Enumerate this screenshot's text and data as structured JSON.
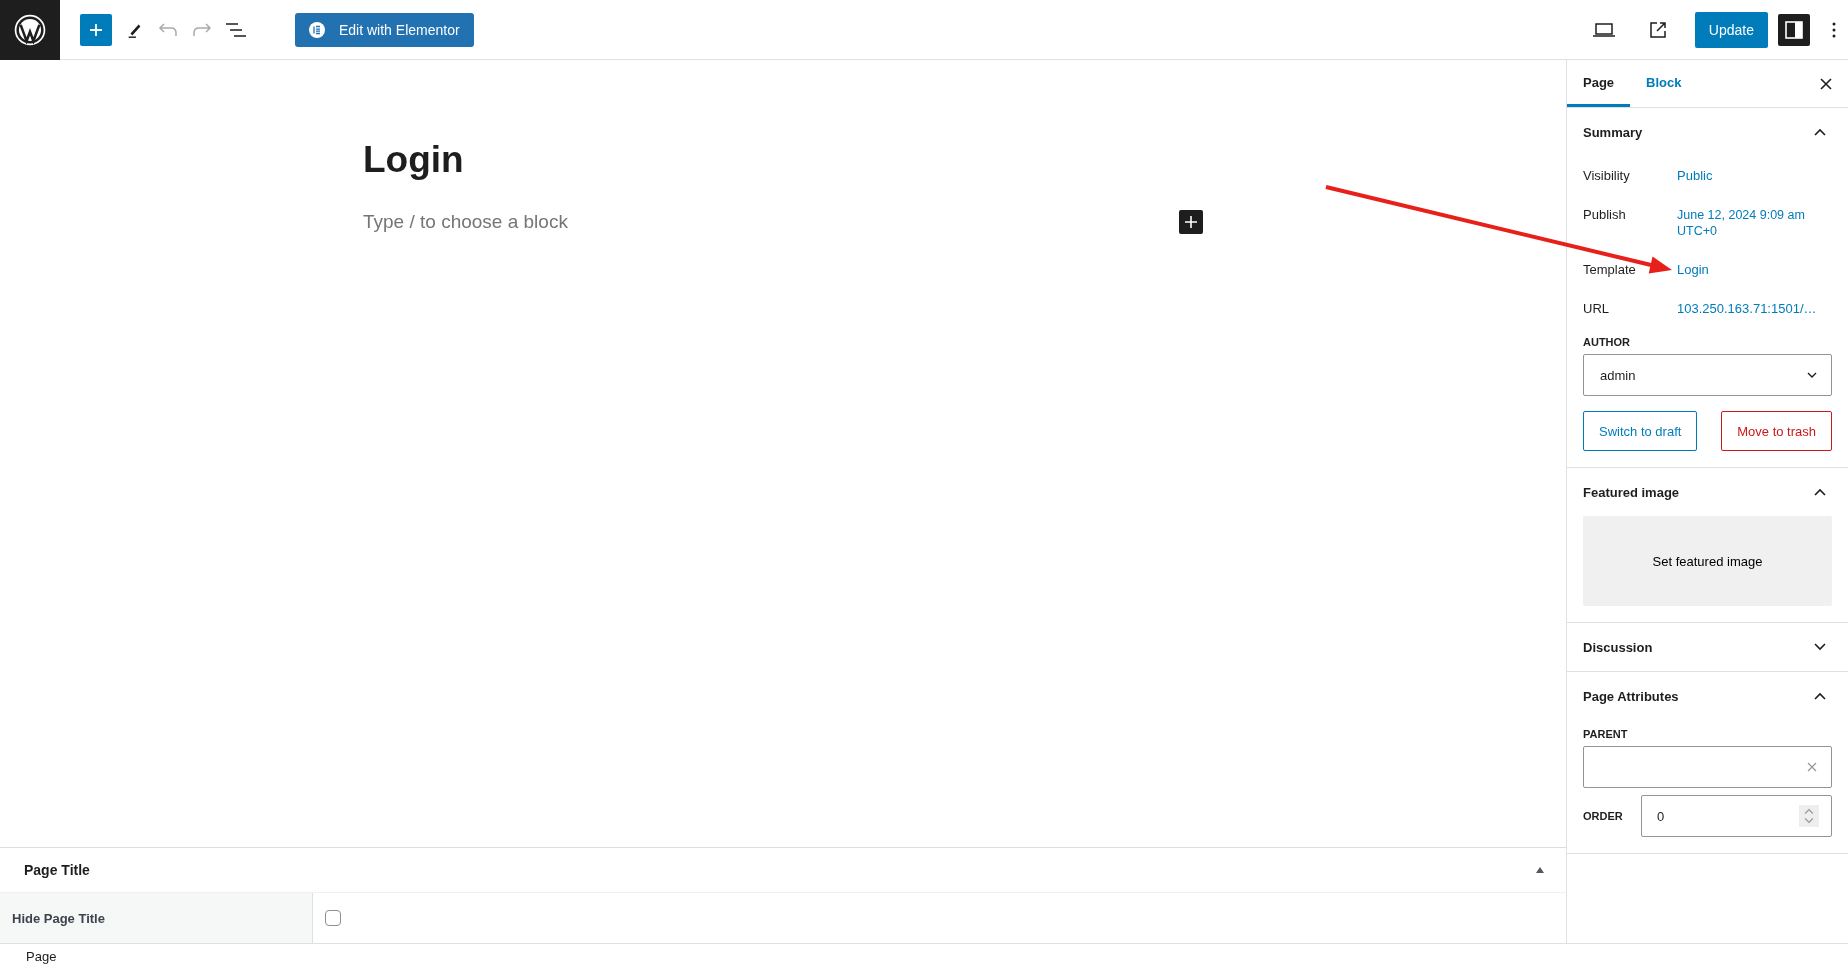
{
  "toolbar": {
    "edit_button": "Edit with Elementor",
    "update_button": "Update"
  },
  "editor": {
    "title": "Login",
    "placeholder": "Type / to choose a block"
  },
  "sidebar": {
    "tabs": [
      {
        "label": "Page",
        "selected": true
      },
      {
        "label": "Block",
        "selected": false
      }
    ],
    "panels": [
      {
        "kind": "summary",
        "title": "Summary",
        "expanded": true,
        "rows": [
          {
            "label": "Visibility",
            "value": "Public"
          },
          {
            "label": "Publish",
            "value": "June 12, 2024 9:09 am UTC+0"
          },
          {
            "label": "Template",
            "value": "Login"
          },
          {
            "label": "URL",
            "value": "103.250.163.71:1501/…"
          }
        ],
        "author_label": "AUTHOR",
        "author": "admin",
        "draft_button": "Switch to draft",
        "trash_button": "Move to trash"
      },
      {
        "kind": "featured",
        "title": "Featured image",
        "expanded": true,
        "button": "Set featured image"
      },
      {
        "title": "Discussion",
        "expanded": false
      },
      {
        "kind": "attributes",
        "title": "Page Attributes",
        "expanded": true,
        "parent_label": "PARENT",
        "order_label": "ORDER",
        "order_value": "0"
      }
    ]
  },
  "meta_box": {
    "title": "Page Title",
    "expanded": true,
    "fields": [
      {
        "label": "Hide Page Title",
        "checked": false
      }
    ]
  },
  "footer": {
    "breadcrumb": "Page"
  }
}
